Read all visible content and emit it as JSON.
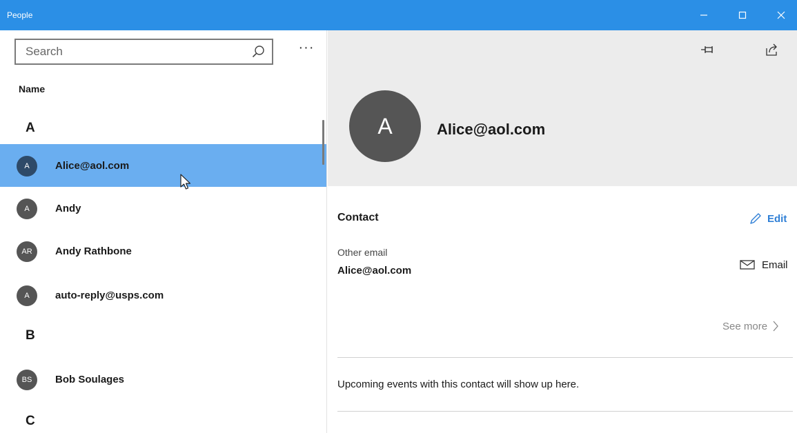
{
  "app": {
    "title": "People"
  },
  "window_controls": {
    "minimize": "minimize-icon",
    "maximize": "maximize-icon",
    "close": "close-icon"
  },
  "search": {
    "placeholder": "Search",
    "value": "",
    "icon": "search-icon"
  },
  "more_button_label": "···",
  "list": {
    "header": "Name",
    "groups": [
      {
        "letter": "A",
        "contacts": [
          {
            "initials": "A",
            "name": "Alice@aol.com",
            "selected": true
          },
          {
            "initials": "A",
            "name": "Andy"
          },
          {
            "initials": "AR",
            "name": "Andy Rathbone"
          },
          {
            "initials": "A",
            "name": "auto-reply@usps.com"
          }
        ]
      },
      {
        "letter": "B",
        "contacts": [
          {
            "initials": "BS",
            "name": "Bob Soulages"
          }
        ]
      },
      {
        "letter": "C",
        "contacts": []
      }
    ]
  },
  "detail": {
    "toolbar": {
      "pin_icon": "pin-icon",
      "share_icon": "share-icon"
    },
    "avatar_initial": "A",
    "display_name": "Alice@aol.com",
    "section_title": "Contact",
    "edit_label": "Edit",
    "field_label": "Other email",
    "field_value": "Alice@aol.com",
    "email_label": "Email",
    "see_more_label": "See more",
    "events_text": "Upcoming events with this contact will show up here."
  },
  "colors": {
    "title_bar": "#2b8fe6",
    "selected_row": "#6aaef0",
    "accent": "#2f7fd6",
    "avatar": "#555555"
  }
}
